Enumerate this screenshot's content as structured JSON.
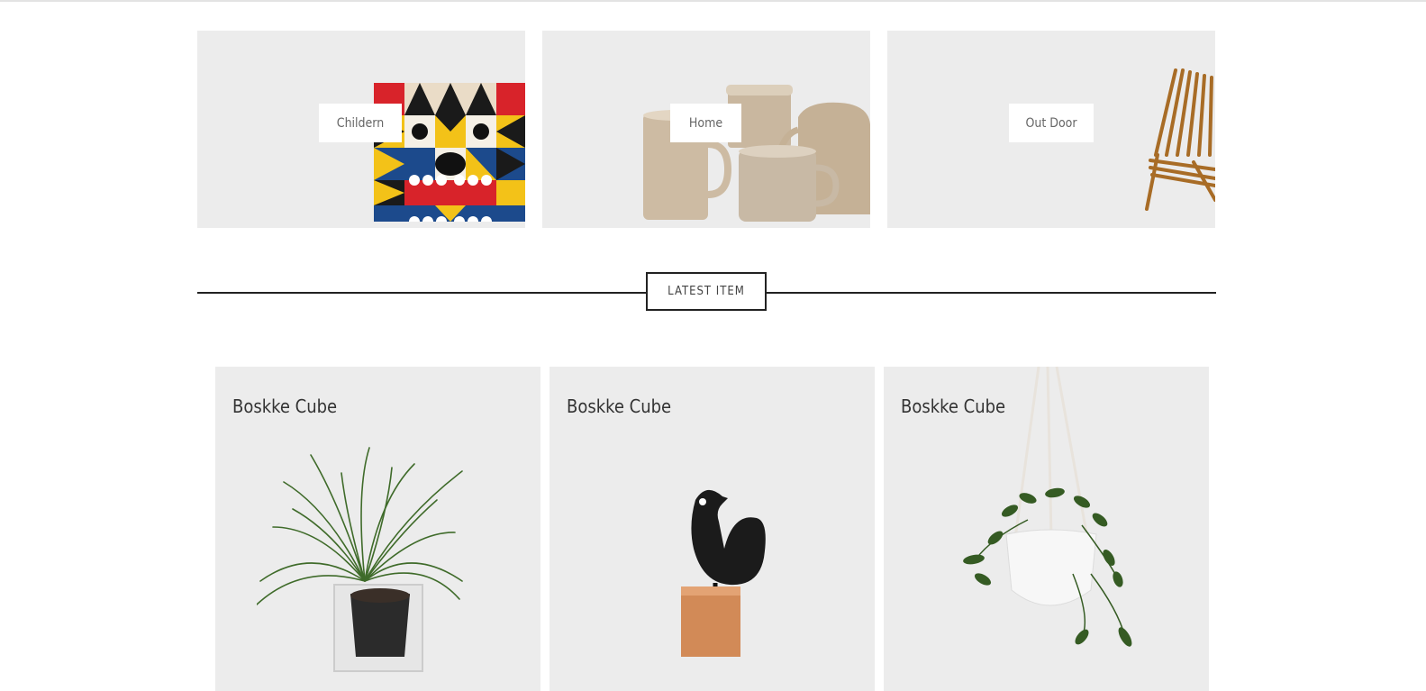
{
  "categories": [
    {
      "label": "Childern"
    },
    {
      "label": "Home"
    },
    {
      "label": "Out Door"
    }
  ],
  "latest_section": {
    "title": "LATEST ITEM"
  },
  "products": [
    {
      "title": "Boskke Cube"
    },
    {
      "title": "Boskke Cube"
    },
    {
      "title": "Boskke Cube"
    }
  ]
}
